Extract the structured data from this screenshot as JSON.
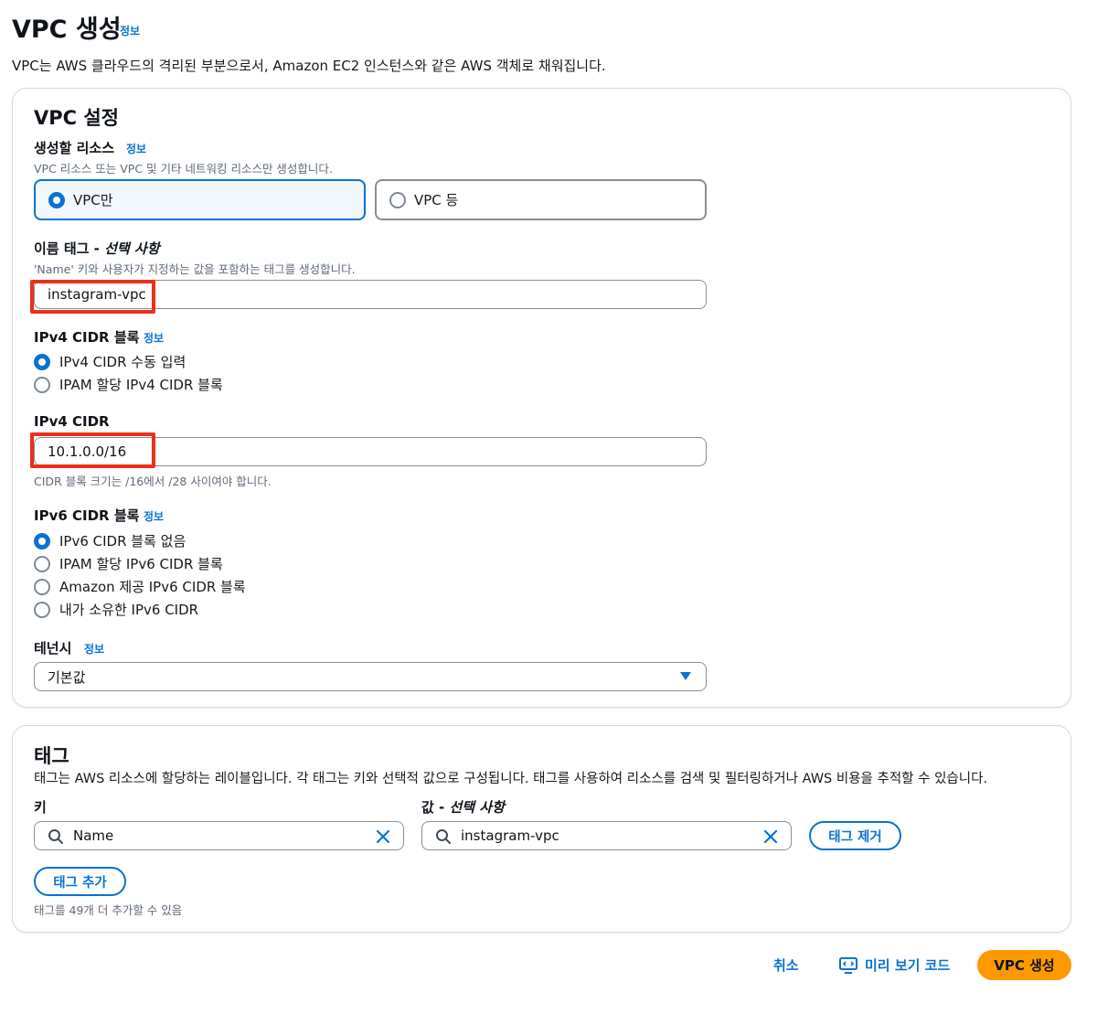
{
  "page": {
    "title": "VPC 생성",
    "title_info": "정보",
    "description": "VPC는 AWS 클라우드의 격리된 부분으로서, Amazon EC2 인스턴스와 같은 AWS 객체로 채워집니다."
  },
  "vpc_settings": {
    "title": "VPC 설정",
    "resources": {
      "label": "생성할 리소스",
      "info": "정보",
      "description": "VPC 리소스 또는 VPC 및 기타 네트워킹 리소스만 생성합니다.",
      "options": [
        "VPC만",
        "VPC 등"
      ],
      "selected": "VPC만"
    },
    "name_tag": {
      "label": "이름 태그 - ",
      "label_optional": "선택 사항",
      "description": "'Name' 키와 사용자가 지정하는 값을 포함하는 태그를 생성합니다.",
      "value": "instagram-vpc"
    },
    "ipv4_block": {
      "label": "IPv4 CIDR 블록",
      "info": "정보",
      "options": [
        "IPv4 CIDR 수동 입력",
        "IPAM 할당 IPv4 CIDR 블록"
      ],
      "selected": "IPv4 CIDR 수동 입력"
    },
    "ipv4_cidr": {
      "label": "IPv4 CIDR",
      "value": "10.1.0.0/16",
      "hint": "CIDR 블록 크기는 /16에서 /28 사이여야 합니다."
    },
    "ipv6_block": {
      "label": "IPv6 CIDR 블록",
      "info": "정보",
      "options": [
        "IPv6 CIDR 블록 없음",
        "IPAM 할당 IPv6 CIDR 블록",
        "Amazon 제공 IPv6 CIDR 블록",
        "내가 소유한 IPv6 CIDR"
      ],
      "selected": "IPv6 CIDR 블록 없음"
    },
    "tenancy": {
      "label": "테넌시",
      "info": "정보",
      "value": "기본값"
    }
  },
  "tags": {
    "title": "태그",
    "description": "태그는 AWS 리소스에 할당하는 레이블입니다. 각 태그는 키와 선택적 값으로 구성됩니다. 태그를 사용하여 리소스를 검색 및 필터링하거나 AWS 비용을 추적할 수 있습니다.",
    "key_label": "키",
    "value_label": "값 - ",
    "value_label_optional": "선택 사항",
    "key_value": "Name",
    "value_value": "instagram-vpc",
    "remove_button": "태그 제거",
    "add_button": "태그 추가",
    "remaining": "태그를 49개 더 추가할 수 있음"
  },
  "footer": {
    "cancel": "취소",
    "preview": "미리 보기 코드",
    "create": "VPC 생성"
  },
  "colors": {
    "accent": "#0972d3",
    "primary_button": "#ff9900",
    "highlight": "#e8301c"
  }
}
